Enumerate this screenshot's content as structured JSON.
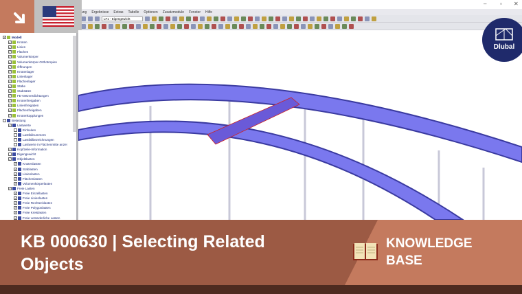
{
  "window": {
    "minimize": "–",
    "maximize": "▫",
    "close": "✕"
  },
  "menu": [
    "ung",
    "Ergebnisse",
    "Extras",
    "Tabelle",
    "Optionen",
    "Zusatzmodule",
    "Fenster",
    "Hilfe"
  ],
  "toolbar": {
    "loadcase": "LF1 - Eigengewicht"
  },
  "tree": [
    {
      "label": "Modell",
      "level": 0,
      "checked": true,
      "bold": true
    },
    {
      "label": "Knoten",
      "level": 1,
      "checked": true
    },
    {
      "label": "Linien",
      "level": 1,
      "checked": true
    },
    {
      "label": "Flächen",
      "level": 1,
      "checked": true
    },
    {
      "label": "Volumenkörper",
      "level": 1,
      "checked": true
    },
    {
      "label": "Volumenkörper-Orthotropien",
      "level": 1,
      "checked": true
    },
    {
      "label": "Öffnungen",
      "level": 1,
      "checked": true
    },
    {
      "label": "Knotenlager",
      "level": 1,
      "checked": true
    },
    {
      "label": "Linienlager",
      "level": 1,
      "checked": true
    },
    {
      "label": "Flächenlager",
      "level": 1,
      "checked": true
    },
    {
      "label": "Stäbe",
      "level": 1,
      "checked": true
    },
    {
      "label": "Stabsätze",
      "level": 1,
      "checked": true
    },
    {
      "label": "FE-Netzverdichtungen",
      "level": 1,
      "checked": true
    },
    {
      "label": "Knotenfreigaben",
      "level": 1,
      "checked": true
    },
    {
      "label": "Linienfreigaben",
      "level": 1,
      "checked": true
    },
    {
      "label": "Flächenfreigaben",
      "level": 1,
      "checked": true
    },
    {
      "label": "Knotenkopplungen",
      "level": 1,
      "checked": true
    },
    {
      "label": "Belastung",
      "level": 0,
      "checked": false
    },
    {
      "label": "Lastwerte",
      "level": 1,
      "checked": true
    },
    {
      "label": "Einheiten",
      "level": 2,
      "checked": false
    },
    {
      "label": "Lastfallnummern",
      "level": 2,
      "checked": false
    },
    {
      "label": "Lastfallbezeichnungen",
      "level": 2,
      "checked": false
    },
    {
      "label": "Lastwerte in Flächenmitte anzei",
      "level": 2,
      "checked": false
    },
    {
      "label": "Kopfzeile-Information",
      "level": 1,
      "checked": true
    },
    {
      "label": "Eigengewicht",
      "level": 1,
      "checked": false
    },
    {
      "label": "Objektlasten",
      "level": 1,
      "checked": true
    },
    {
      "label": "Knotenlasten",
      "level": 2,
      "checked": true
    },
    {
      "label": "Stablasten",
      "level": 2,
      "checked": true
    },
    {
      "label": "Linienlasten",
      "level": 2,
      "checked": true
    },
    {
      "label": "Flächenlasten",
      "level": 2,
      "checked": true
    },
    {
      "label": "Volumenkörperlasten",
      "level": 2,
      "checked": true
    },
    {
      "label": "Freie Lasten",
      "level": 1,
      "checked": true
    },
    {
      "label": "Freie Einzellasten",
      "level": 2,
      "checked": true
    },
    {
      "label": "Freie Linienlasten",
      "level": 2,
      "checked": true
    },
    {
      "label": "Freie Rechtecklasten",
      "level": 2,
      "checked": true
    },
    {
      "label": "Freie Polygonlasten",
      "level": 2,
      "checked": true
    },
    {
      "label": "Freie Kreislasten",
      "level": 2,
      "checked": true
    },
    {
      "label": "Freie veränderliche Lasten",
      "level": 2,
      "checked": true
    }
  ],
  "banner": {
    "title": "KB 000630 | Selecting Related Objects",
    "category": "KNOWLEDGE BASE"
  },
  "logo": {
    "text": "Dlubal"
  },
  "colors": {
    "banner": "#c47a5e",
    "banner_dark": "#9c5a44",
    "bottom": "#4e2b20",
    "beam": "#7a78ee",
    "logo": "#1f2a6b"
  }
}
